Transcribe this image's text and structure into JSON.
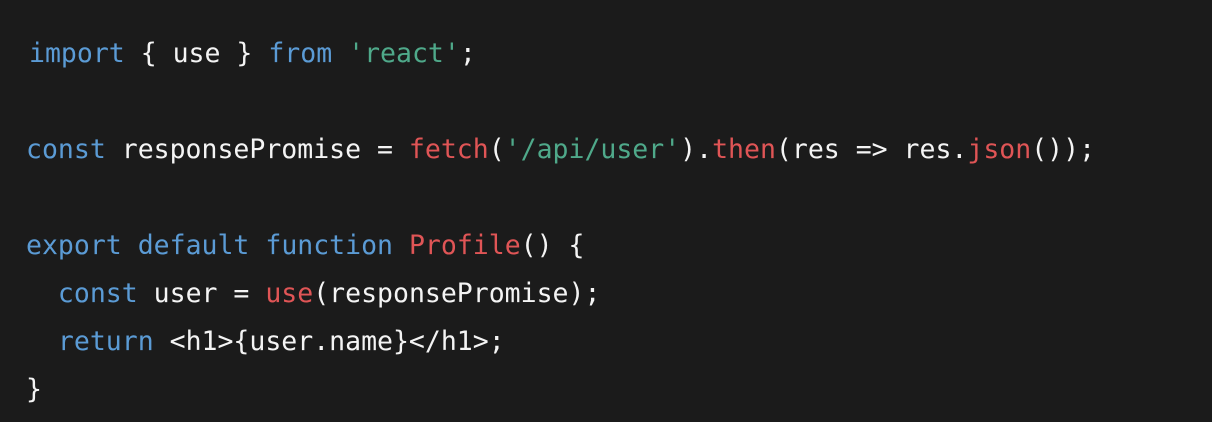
{
  "colors": {
    "background": "#1b1b1b",
    "keyword": "#5b9bd5",
    "string": "#4fa98a",
    "function": "#e05556",
    "plain": "#f4f4f4"
  },
  "code": {
    "lines": [
      [
        {
          "t": "kw",
          "v": "import"
        },
        {
          "t": "txt",
          "v": " { use } "
        },
        {
          "t": "kw",
          "v": "from"
        },
        {
          "t": "txt",
          "v": " "
        },
        {
          "t": "str",
          "v": "'react'"
        },
        {
          "t": "txt",
          "v": ";"
        }
      ],
      [],
      [
        {
          "t": "kw",
          "v": "const"
        },
        {
          "t": "txt",
          "v": " responsePromise = "
        },
        {
          "t": "fn",
          "v": "fetch"
        },
        {
          "t": "txt",
          "v": "("
        },
        {
          "t": "str",
          "v": "'/api/user'"
        },
        {
          "t": "txt",
          "v": ")."
        },
        {
          "t": "fn",
          "v": "then"
        },
        {
          "t": "txt",
          "v": "(res => res."
        },
        {
          "t": "fn",
          "v": "json"
        },
        {
          "t": "txt",
          "v": "());"
        }
      ],
      [],
      [
        {
          "t": "kw",
          "v": "export"
        },
        {
          "t": "txt",
          "v": " "
        },
        {
          "t": "kw",
          "v": "default"
        },
        {
          "t": "txt",
          "v": " "
        },
        {
          "t": "kw",
          "v": "function"
        },
        {
          "t": "txt",
          "v": " "
        },
        {
          "t": "fn",
          "v": "Profile"
        },
        {
          "t": "txt",
          "v": "() {"
        }
      ],
      [
        {
          "t": "txt",
          "v": "  "
        },
        {
          "t": "kw",
          "v": "const"
        },
        {
          "t": "txt",
          "v": " user = "
        },
        {
          "t": "fn",
          "v": "use"
        },
        {
          "t": "txt",
          "v": "(responsePromise);"
        }
      ],
      [
        {
          "t": "txt",
          "v": "  "
        },
        {
          "t": "kw",
          "v": "return"
        },
        {
          "t": "txt",
          "v": " <h1>{user.name}</h1>;"
        }
      ],
      [
        {
          "t": "txt",
          "v": "}"
        }
      ]
    ]
  }
}
